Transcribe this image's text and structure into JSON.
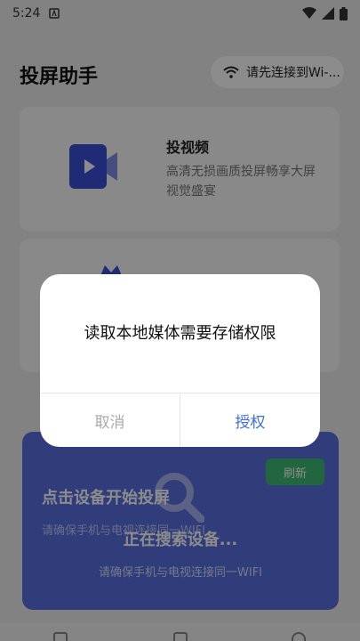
{
  "status_bar": {
    "time": "5:24"
  },
  "header": {
    "title": "投屏助手",
    "wifi_text": "请先连接到Wi-..."
  },
  "video_card": {
    "title": "投视频",
    "desc": "高清无损画质投屏畅享大屏视觉盛宴"
  },
  "device_panel": {
    "refresh_label": "刷新",
    "title": "点击设备开始投屏",
    "subtitle": "请确保手机与电视连接同一WIFI",
    "searching": "正在搜索设备...",
    "hint": "请确保手机与电视连接同一WIFI"
  },
  "dialog": {
    "message": "读取本地媒体需要存储权限",
    "cancel_label": "取消",
    "grant_label": "授权"
  },
  "colors": {
    "accent": "#3f6fe0",
    "panel": "#5a6fe0",
    "refresh": "#3fbb74"
  }
}
